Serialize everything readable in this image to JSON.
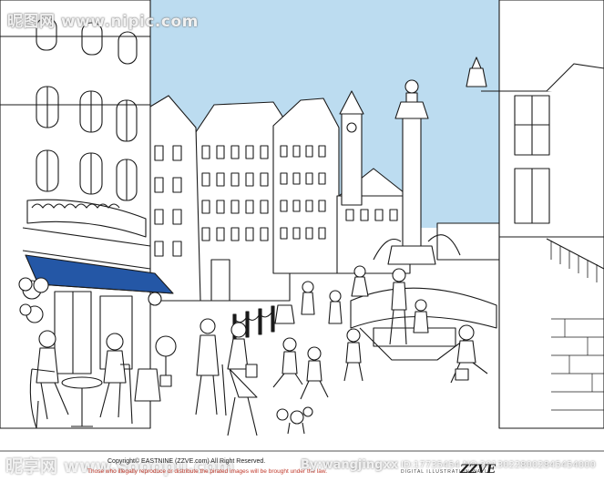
{
  "watermarks": {
    "top": "昵图网 www.nipic.com",
    "bottom_left": "昵享网 www.sooopu.com",
    "by": "By:wangjingxx",
    "id": "ID:17735454 NO:20130228002845454000"
  },
  "footer": {
    "copyright": "Copyright© EASTNINE (ZZVE.com) All Right Reserved.",
    "pirate_notice": "Those who illegally reproduce or distribute the pirated images will be brought under the law.",
    "brand": "ZZVE",
    "brand_sub": "DIGITAL ILLUSTRATION WALL"
  },
  "colors": {
    "sky": "#bcdcf0",
    "awning": "#2457a6",
    "ink": "#1a1a1a",
    "paper": "#ffffff"
  }
}
